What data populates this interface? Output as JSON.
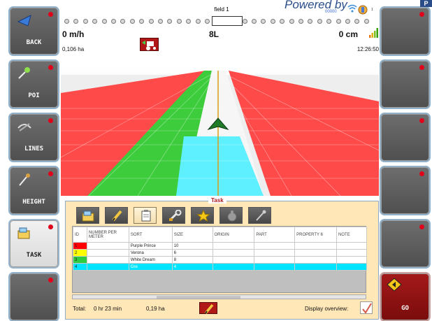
{
  "left_buttons": [
    {
      "label": "BACK",
      "icon": "arrow-left-icon"
    },
    {
      "label": "POI",
      "icon": "pin-icon"
    },
    {
      "label": "LINES",
      "icon": "lines-icon"
    },
    {
      "label": "HEIGHT",
      "icon": "height-icon"
    },
    {
      "label": "TASK",
      "icon": "task-icon"
    },
    {
      "label": "",
      "icon": ""
    }
  ],
  "right_buttons": [
    {
      "label": ""
    },
    {
      "label": ""
    },
    {
      "label": ""
    },
    {
      "label": ""
    },
    {
      "label": ""
    },
    {
      "label": "GO",
      "icon": "go-icon"
    }
  ],
  "header": {
    "field_title": "field 1",
    "speed": "0 m/h",
    "area": "0,106 ha",
    "line": "8L",
    "deviation": "0 cm",
    "clock": "12:26:50",
    "brand": "Powered by",
    "brand_badge": "P",
    "status_text": "00000",
    "battery_level": "1"
  },
  "task": {
    "title": "Task",
    "tabs": [
      {
        "icon": "folder-open-icon",
        "active": false
      },
      {
        "icon": "pencil-icon",
        "active": false
      },
      {
        "icon": "clipboard-icon",
        "active": true
      },
      {
        "icon": "wrench-icon",
        "active": false
      },
      {
        "icon": "star-icon",
        "active": false
      },
      {
        "icon": "drop-icon",
        "active": false
      },
      {
        "icon": "shovel-icon",
        "active": false
      }
    ],
    "columns": [
      "ID",
      "NUMBER PER METER",
      "SORT",
      "SIZE",
      "ORIGIN",
      "PART",
      "PROPERTY 6",
      "NOTE"
    ],
    "rows": [
      {
        "id": "1",
        "color": "#ff0000",
        "number": "",
        "sort": "Purple Prince",
        "size": "10",
        "origin": "",
        "part": "",
        "prop6": "",
        "note": ""
      },
      {
        "id": "2",
        "color": "#ffff00",
        "number": "",
        "sort": "Verona",
        "size": "6",
        "origin": "",
        "part": "",
        "prop6": "",
        "note": ""
      },
      {
        "id": "3",
        "color": "#2ecc40",
        "number": "",
        "sort": "White Dream",
        "size": "8",
        "origin": "",
        "part": "",
        "prop6": "",
        "note": ""
      },
      {
        "id": "4",
        "color": "#00e5ff",
        "number": "",
        "sort": "Gre",
        "size": "4",
        "origin": "",
        "part": "",
        "prop6": "",
        "note": "",
        "selected": true
      }
    ],
    "total_label": "Total:",
    "total_time": "0 hr 23 min",
    "total_ha": "0,19 ha",
    "display_overview_label": "Display overview:",
    "display_overview_checked": true
  },
  "colors": {
    "red_strip": "#ff4a4a",
    "green_strip": "#3ccc3c",
    "cyan_strip": "#5ff0ff",
    "accent": "#b01818"
  }
}
